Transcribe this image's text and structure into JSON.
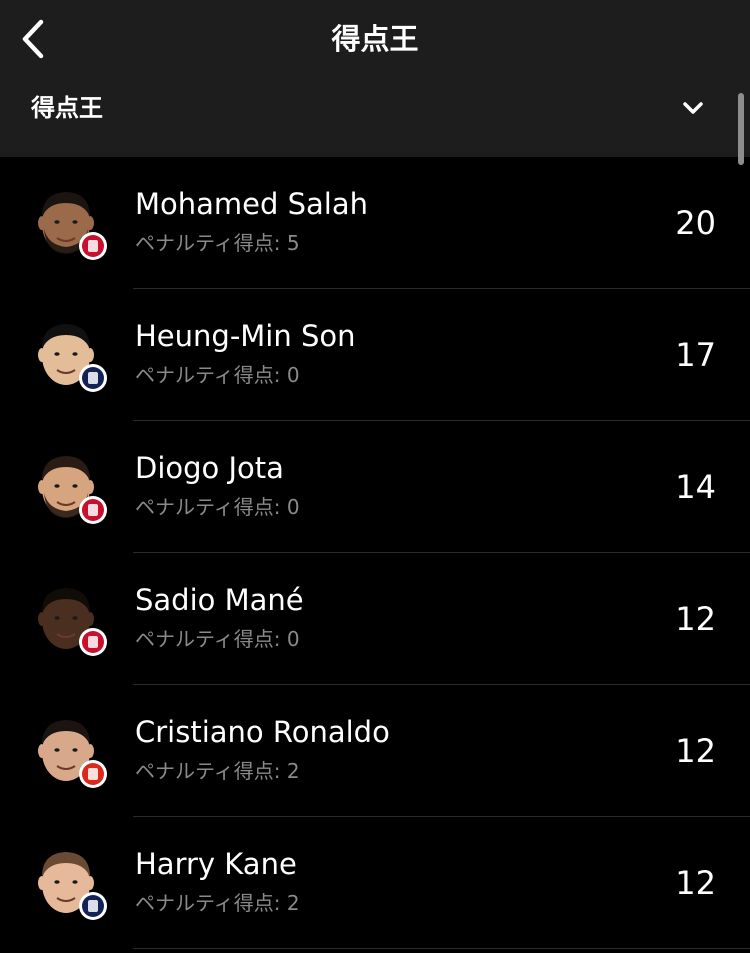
{
  "nav": {
    "title": "得点王",
    "back_icon": "chevron-left-icon"
  },
  "selector": {
    "label": "得点王",
    "icon": "chevron-down-icon"
  },
  "players": [
    {
      "name": "Mohamed Salah",
      "penalty_label": "ペナルティ得点:",
      "penalty_goals": "5",
      "goals": "20",
      "club_badge": "liverpool-badge-icon",
      "skin": "#9b6a4a",
      "hair": "#1c1410",
      "beard": true,
      "badge_color": "#c8102e"
    },
    {
      "name": "Heung-Min Son",
      "penalty_label": "ペナルティ得点:",
      "penalty_goals": "0",
      "goals": "17",
      "club_badge": "tottenham-badge-icon",
      "skin": "#e2bd98",
      "hair": "#111111",
      "beard": false,
      "badge_color": "#132257"
    },
    {
      "name": "Diogo Jota",
      "penalty_label": "ペナルティ得点:",
      "penalty_goals": "0",
      "goals": "14",
      "club_badge": "liverpool-badge-icon",
      "skin": "#d6a47e",
      "hair": "#2a1c14",
      "beard": true,
      "badge_color": "#c8102e"
    },
    {
      "name": "Sadio Mané",
      "penalty_label": "ペナルティ得点:",
      "penalty_goals": "0",
      "goals": "12",
      "club_badge": "liverpool-badge-icon",
      "skin": "#4a2e20",
      "hair": "#120c08",
      "beard": false,
      "badge_color": "#c8102e"
    },
    {
      "name": "Cristiano Ronaldo",
      "penalty_label": "ペナルティ得点:",
      "penalty_goals": "2",
      "goals": "12",
      "club_badge": "manchester-united-badge-icon",
      "skin": "#d7a98a",
      "hair": "#1b1410",
      "beard": false,
      "badge_color": "#da291c"
    },
    {
      "name": "Harry Kane",
      "penalty_label": "ペナルティ得点:",
      "penalty_goals": "2",
      "goals": "12",
      "club_badge": "tottenham-badge-icon",
      "skin": "#e6b99a",
      "hair": "#6b4a34",
      "beard": false,
      "badge_color": "#132257"
    }
  ]
}
